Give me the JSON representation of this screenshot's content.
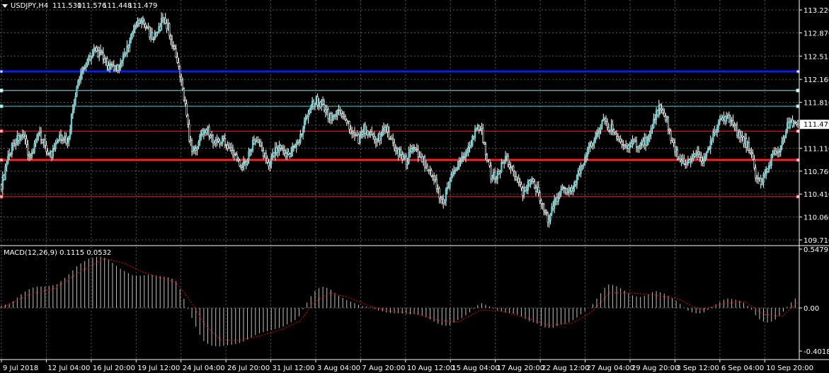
{
  "chart_data": [
    {
      "type": "candlestick",
      "title": "USDJPY,H4",
      "ohlc": {
        "open": "111.530",
        "high": "111.576",
        "low": "111.448",
        "close": "111.479"
      },
      "current_price": "111.479",
      "ylim": [
        109.71,
        113.22
      ],
      "y_ticks": [
        "113.220",
        "112.870",
        "112.515",
        "112.160",
        "111.810",
        "111.460",
        "111.110",
        "110.760",
        "110.410",
        "110.060",
        "109.710"
      ],
      "x_ticks": [
        "9 Jul 2018",
        "12 Jul 04:00",
        "16 Jul 20:00",
        "19 Jul 12:00",
        "24 Jul 04:00",
        "26 Jul 20:00",
        "31 Jul 12:00",
        "3 Aug 04:00",
        "7 Aug 20:00",
        "10 Aug 12:00",
        "15 Aug 04:00",
        "17 Aug 20:00",
        "22 Aug 12:00",
        "27 Aug 04:00",
        "29 Aug 20:00",
        "3 Sep 12:00",
        "6 Sep 04:00",
        "10 Sep 20:00"
      ],
      "close_path": [
        [
          0,
          110.55
        ],
        [
          8,
          111.15
        ],
        [
          14,
          111.3
        ],
        [
          18,
          111.2
        ],
        [
          22,
          110.95
        ],
        [
          26,
          111.25
        ],
        [
          30,
          111.3
        ],
        [
          34,
          111.1
        ],
        [
          38,
          111.0
        ],
        [
          42,
          111.2
        ],
        [
          46,
          111.3
        ],
        [
          50,
          111.2
        ],
        [
          54,
          111.7
        ],
        [
          58,
          112.1
        ],
        [
          62,
          112.35
        ],
        [
          66,
          112.5
        ],
        [
          70,
          112.6
        ],
        [
          74,
          112.55
        ],
        [
          78,
          112.45
        ],
        [
          82,
          112.35
        ],
        [
          86,
          112.3
        ],
        [
          90,
          112.4
        ],
        [
          96,
          112.7
        ],
        [
          102,
          113.0
        ],
        [
          106,
          113.05
        ],
        [
          110,
          112.95
        ],
        [
          114,
          112.8
        ],
        [
          118,
          112.85
        ],
        [
          122,
          113.1
        ],
        [
          126,
          112.95
        ],
        [
          130,
          112.65
        ],
        [
          134,
          112.3
        ],
        [
          138,
          111.9
        ],
        [
          140,
          111.65
        ],
        [
          142,
          111.2
        ],
        [
          146,
          111.05
        ],
        [
          150,
          111.3
        ],
        [
          154,
          111.45
        ],
        [
          158,
          111.3
        ],
        [
          162,
          111.2
        ],
        [
          166,
          111.25
        ],
        [
          170,
          111.2
        ],
        [
          174,
          111.05
        ],
        [
          178,
          110.95
        ],
        [
          182,
          110.85
        ],
        [
          186,
          110.95
        ],
        [
          190,
          111.2
        ],
        [
          194,
          111.25
        ],
        [
          198,
          111.0
        ],
        [
          202,
          110.9
        ],
        [
          206,
          111.05
        ],
        [
          210,
          111.1
        ],
        [
          214,
          111.0
        ],
        [
          218,
          111.05
        ],
        [
          222,
          111.15
        ],
        [
          226,
          111.3
        ],
        [
          230,
          111.6
        ],
        [
          234,
          111.75
        ],
        [
          238,
          111.85
        ],
        [
          242,
          111.8
        ],
        [
          246,
          111.65
        ],
        [
          250,
          111.55
        ],
        [
          254,
          111.7
        ],
        [
          258,
          111.6
        ],
        [
          262,
          111.45
        ],
        [
          266,
          111.3
        ],
        [
          270,
          111.25
        ],
        [
          274,
          111.4
        ],
        [
          278,
          111.35
        ],
        [
          282,
          111.2
        ],
        [
          286,
          111.3
        ],
        [
          290,
          111.4
        ],
        [
          294,
          111.3
        ],
        [
          298,
          111.1
        ],
        [
          302,
          111.0
        ],
        [
          306,
          110.9
        ],
        [
          310,
          111.1
        ],
        [
          314,
          111.05
        ],
        [
          318,
          110.95
        ],
        [
          322,
          110.8
        ],
        [
          326,
          110.7
        ],
        [
          330,
          110.45
        ],
        [
          334,
          110.3
        ],
        [
          338,
          110.55
        ],
        [
          342,
          110.8
        ],
        [
          346,
          110.9
        ],
        [
          350,
          111.0
        ],
        [
          354,
          111.15
        ],
        [
          358,
          111.35
        ],
        [
          362,
          111.45
        ],
        [
          366,
          111.05
        ],
        [
          370,
          110.7
        ],
        [
          374,
          110.65
        ],
        [
          378,
          110.85
        ],
        [
          382,
          110.95
        ],
        [
          386,
          110.8
        ],
        [
          390,
          110.6
        ],
        [
          394,
          110.45
        ],
        [
          398,
          110.55
        ],
        [
          402,
          110.6
        ],
        [
          406,
          110.4
        ],
        [
          410,
          110.15
        ],
        [
          414,
          110.0
        ],
        [
          418,
          110.3
        ],
        [
          422,
          110.4
        ],
        [
          426,
          110.5
        ],
        [
          430,
          110.45
        ],
        [
          434,
          110.6
        ],
        [
          438,
          110.8
        ],
        [
          442,
          111.0
        ],
        [
          446,
          111.2
        ],
        [
          450,
          111.35
        ],
        [
          454,
          111.55
        ],
        [
          458,
          111.45
        ],
        [
          462,
          111.4
        ],
        [
          466,
          111.3
        ],
        [
          470,
          111.1
        ],
        [
          474,
          111.15
        ],
        [
          478,
          111.2
        ],
        [
          482,
          111.1
        ],
        [
          486,
          111.2
        ],
        [
          490,
          111.3
        ],
        [
          494,
          111.6
        ],
        [
          498,
          111.75
        ],
        [
          502,
          111.6
        ],
        [
          506,
          111.3
        ],
        [
          510,
          111.05
        ],
        [
          514,
          110.9
        ],
        [
          518,
          110.85
        ],
        [
          522,
          110.95
        ],
        [
          526,
          111.05
        ],
        [
          530,
          110.95
        ],
        [
          534,
          111.1
        ],
        [
          538,
          111.3
        ],
        [
          542,
          111.5
        ],
        [
          546,
          111.6
        ],
        [
          550,
          111.55
        ],
        [
          554,
          111.45
        ],
        [
          558,
          111.3
        ],
        [
          562,
          111.2
        ],
        [
          566,
          111.05
        ],
        [
          570,
          110.7
        ],
        [
          574,
          110.55
        ],
        [
          578,
          110.75
        ],
        [
          582,
          110.95
        ],
        [
          586,
          111.05
        ],
        [
          590,
          111.2
        ],
        [
          594,
          111.45
        ],
        [
          598,
          111.5
        ],
        [
          602,
          111.48
        ]
      ],
      "horizontal_levels": [
        {
          "price": 112.28,
          "color": "#0a1fe6"
        },
        {
          "price": 111.99,
          "color": "#8fe8e8"
        },
        {
          "price": 111.75,
          "color": "#3fd3d3"
        },
        {
          "price": 111.37,
          "color": "#ff2020"
        },
        {
          "price": 110.93,
          "color": "#ff2020"
        },
        {
          "price": 110.37,
          "color": "#ff2020"
        }
      ],
      "colors": {
        "bull_body": "#5fd3d3",
        "bear_body": "#ffffff",
        "wick": "#ffffff",
        "grid": "#5a5a5a",
        "price_box": "#ffffff"
      }
    },
    {
      "type": "bar",
      "title": "MACD(12,26,9) 0.1115 0.0532",
      "ylim": [
        -0.4018,
        0.5479
      ],
      "y_ticks": [
        "0.5479",
        "0.00",
        "-0.4018"
      ],
      "histogram_path": [
        [
          0,
          0.02
        ],
        [
          8,
          0.05
        ],
        [
          14,
          0.12
        ],
        [
          20,
          0.17
        ],
        [
          26,
          0.2
        ],
        [
          34,
          0.2
        ],
        [
          42,
          0.22
        ],
        [
          50,
          0.3
        ],
        [
          58,
          0.4
        ],
        [
          66,
          0.46
        ],
        [
          74,
          0.48
        ],
        [
          80,
          0.46
        ],
        [
          86,
          0.4
        ],
        [
          92,
          0.35
        ],
        [
          100,
          0.3
        ],
        [
          106,
          0.3
        ],
        [
          112,
          0.31
        ],
        [
          118,
          0.3
        ],
        [
          124,
          0.29
        ],
        [
          128,
          0.28
        ],
        [
          132,
          0.25
        ],
        [
          136,
          0.15
        ],
        [
          140,
          0.02
        ],
        [
          146,
          -0.15
        ],
        [
          152,
          -0.3
        ],
        [
          158,
          -0.35
        ],
        [
          164,
          -0.36
        ],
        [
          170,
          -0.35
        ],
        [
          176,
          -0.34
        ],
        [
          182,
          -0.32
        ],
        [
          188,
          -0.28
        ],
        [
          194,
          -0.24
        ],
        [
          200,
          -0.22
        ],
        [
          206,
          -0.2
        ],
        [
          212,
          -0.18
        ],
        [
          218,
          -0.14
        ],
        [
          224,
          -0.1
        ],
        [
          230,
          0.03
        ],
        [
          236,
          0.15
        ],
        [
          242,
          0.2
        ],
        [
          248,
          0.18
        ],
        [
          254,
          0.12
        ],
        [
          260,
          0.08
        ],
        [
          266,
          0.05
        ],
        [
          272,
          0.02
        ],
        [
          278,
          0.01
        ],
        [
          284,
          -0.02
        ],
        [
          290,
          -0.04
        ],
        [
          296,
          -0.05
        ],
        [
          302,
          -0.05
        ],
        [
          308,
          -0.06
        ],
        [
          314,
          -0.06
        ],
        [
          320,
          -0.08
        ],
        [
          326,
          -0.12
        ],
        [
          332,
          -0.16
        ],
        [
          338,
          -0.17
        ],
        [
          344,
          -0.12
        ],
        [
          350,
          -0.08
        ],
        [
          356,
          -0.02
        ],
        [
          362,
          0.05
        ],
        [
          368,
          0.02
        ],
        [
          374,
          -0.02
        ],
        [
          380,
          -0.04
        ],
        [
          386,
          -0.05
        ],
        [
          392,
          -0.07
        ],
        [
          398,
          -0.12
        ],
        [
          404,
          -0.14
        ],
        [
          410,
          -0.18
        ],
        [
          416,
          -0.19
        ],
        [
          422,
          -0.16
        ],
        [
          428,
          -0.14
        ],
        [
          434,
          -0.1
        ],
        [
          440,
          -0.04
        ],
        [
          446,
          0.02
        ],
        [
          452,
          0.12
        ],
        [
          458,
          0.22
        ],
        [
          464,
          0.21
        ],
        [
          470,
          0.17
        ],
        [
          476,
          0.12
        ],
        [
          482,
          0.1
        ],
        [
          488,
          0.12
        ],
        [
          494,
          0.16
        ],
        [
          500,
          0.14
        ],
        [
          506,
          0.1
        ],
        [
          512,
          0.05
        ],
        [
          518,
          -0.02
        ],
        [
          524,
          -0.05
        ],
        [
          530,
          -0.05
        ],
        [
          536,
          0.0
        ],
        [
          542,
          0.05
        ],
        [
          548,
          0.09
        ],
        [
          554,
          0.08
        ],
        [
          560,
          0.06
        ],
        [
          566,
          0.0
        ],
        [
          572,
          -0.1
        ],
        [
          578,
          -0.14
        ],
        [
          584,
          -0.12
        ],
        [
          590,
          -0.05
        ],
        [
          596,
          0.04
        ],
        [
          602,
          0.1115
        ]
      ],
      "signal_path": [
        [
          0,
          0.0
        ],
        [
          20,
          0.12
        ],
        [
          40,
          0.18
        ],
        [
          60,
          0.34
        ],
        [
          78,
          0.46
        ],
        [
          92,
          0.42
        ],
        [
          106,
          0.34
        ],
        [
          120,
          0.28
        ],
        [
          132,
          0.24
        ],
        [
          142,
          0.08
        ],
        [
          154,
          -0.16
        ],
        [
          166,
          -0.3
        ],
        [
          180,
          -0.3
        ],
        [
          196,
          -0.26
        ],
        [
          212,
          -0.2
        ],
        [
          226,
          -0.12
        ],
        [
          236,
          0.05
        ],
        [
          248,
          0.14
        ],
        [
          262,
          0.1
        ],
        [
          278,
          0.02
        ],
        [
          294,
          -0.03
        ],
        [
          312,
          -0.05
        ],
        [
          332,
          -0.12
        ],
        [
          346,
          -0.13
        ],
        [
          362,
          -0.02
        ],
        [
          378,
          -0.03
        ],
        [
          398,
          -0.1
        ],
        [
          414,
          -0.16
        ],
        [
          432,
          -0.14
        ],
        [
          446,
          -0.04
        ],
        [
          460,
          0.14
        ],
        [
          476,
          0.14
        ],
        [
          494,
          0.12
        ],
        [
          512,
          0.08
        ],
        [
          528,
          -0.02
        ],
        [
          546,
          0.04
        ],
        [
          562,
          0.06
        ],
        [
          576,
          -0.06
        ],
        [
          590,
          -0.08
        ],
        [
          602,
          0.0532
        ]
      ],
      "colors": {
        "histogram": "#c0c0c0",
        "signal": "#e01010"
      }
    }
  ]
}
